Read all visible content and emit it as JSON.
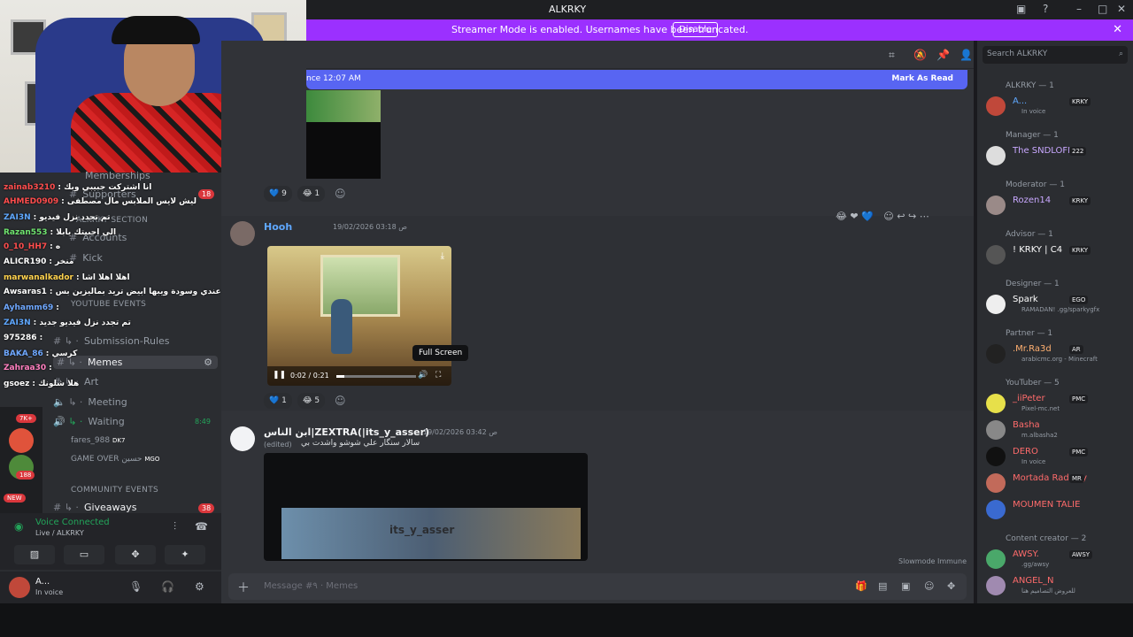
{
  "app": {
    "title": "ALKRKY"
  },
  "banner": {
    "message": "Streamer Mode is enabled. Usernames have been truncated.",
    "disable_label": "Disable"
  },
  "header": {
    "search_placeholder": "Search ALKRKY"
  },
  "newbar": {
    "since": "nce 12:07 AM",
    "mark_read": "Mark As Read"
  },
  "sidebar": {
    "channels": [
      {
        "label": "Memberships"
      },
      {
        "label": "Supporters",
        "badge": "18"
      },
      {
        "label": "Accounts"
      },
      {
        "label": "Kick"
      },
      {
        "label": "Submission-Rules"
      },
      {
        "label": "Memes"
      },
      {
        "label": "Art"
      },
      {
        "label": "Meeting"
      },
      {
        "label": "Waiting",
        "time": "8:49"
      },
      {
        "label": "Giveaways",
        "badge": "38"
      }
    ],
    "categories": [
      "ALKRKY SECTION",
      "YOUTUBE EVENTS",
      "COMMUNITY EVENTS"
    ],
    "voice_users": [
      {
        "name": "fares_988",
        "tag": "DK7"
      },
      {
        "name": "GAME OVER حسين",
        "tag": "MGO"
      }
    ],
    "server_badges": [
      "7K+",
      "188",
      "NEW"
    ]
  },
  "overlay_chat": [
    {
      "user": "zainab3210",
      "text": "انا اشتركت جبيبي وبك",
      "color": "#ff4d4d"
    },
    {
      "user": "AHMED0909",
      "text": "ليش لايس الملابس مال مصطفى",
      "color": "#ff4d4d"
    },
    {
      "user": "ZAI3N",
      "text": "تم تجدد نزل فيديو",
      "color": "#5fa8ff"
    },
    {
      "user": "Razan553",
      "text": "الي احبيتك يابلا",
      "color": "#6fe36f"
    },
    {
      "user": "0_10_HH7",
      "text": "ه",
      "color": "#ff4d4d"
    },
    {
      "user": "ALICR190",
      "text": "منخر",
      "color": "#ffffff"
    },
    {
      "user": "marwanalkador",
      "text": "اهلا اهلا اشا",
      "color": "#ffd24d"
    },
    {
      "user": "Awsaras1",
      "text": "اني عندي وسودة ويبها ابيض تريد بماليزين بس",
      "color": "#ffffff"
    },
    {
      "user": "Ayhamm69",
      "text": "",
      "color": "#6fa8ff"
    },
    {
      "user": "ZAI3N",
      "text": "تم تجدد نزل فيديو جديد",
      "color": "#5fa8ff"
    },
    {
      "user": "975286",
      "text": "",
      "color": "#ffffff"
    },
    {
      "user": "BAKA_86",
      "text": "كرسي",
      "color": "#6fa8ff"
    },
    {
      "user": "Zahraa30",
      "text": "",
      "color": "#ff7fbf"
    },
    {
      "user": "gsoez",
      "text": "هلا شلونك",
      "color": "#ffffff"
    }
  ],
  "voice": {
    "status": "Voice Connected",
    "location": "Live / ALKRKY"
  },
  "user": {
    "name": "A...",
    "status": "In voice"
  },
  "messages": {
    "first_reactions": [
      "9",
      "1"
    ],
    "second": {
      "author": "Hooh",
      "time": "19/02/2026 03:18 ص",
      "video_time": "0:02 / 0:21",
      "progress": 0.1,
      "tooltip": "Full Screen",
      "reactions": [
        "1",
        "5"
      ]
    },
    "third": {
      "author": "ابن الناس|ZEXTRA(|its_y_asser)",
      "time": "19/02/2026 03:42 ص",
      "edited": "(edited)",
      "body": "سالار سنگار علي شوشو واشدت بي",
      "watermark": "its_y_asser"
    }
  },
  "composer": {
    "placeholder": "Message #٩ · Memes",
    "slowmode": "Slowmode Immune"
  },
  "members": [
    {
      "role": "ALKRKY — 1",
      "people": [
        {
          "name": "A...",
          "status": "In voice",
          "tag": "KRKY",
          "color": "#5fa8ff"
        }
      ]
    },
    {
      "role": "Manager — 1",
      "people": [
        {
          "name": "The SNDLOFI",
          "status": "",
          "tag": "222",
          "color": "#c9a8ff"
        }
      ]
    },
    {
      "role": "Moderator — 1",
      "people": [
        {
          "name": "Rozen14",
          "status": "",
          "tag": "KRKY",
          "color": "#c9a8ff"
        }
      ]
    },
    {
      "role": "Advisor — 1",
      "people": [
        {
          "name": "! KRKY | C4",
          "status": "",
          "tag": "KRKY",
          "color": "#ffffff"
        }
      ]
    },
    {
      "role": "Designer — 1",
      "people": [
        {
          "name": "Spark",
          "status": "RAMADAN! .gg/sparkygfx",
          "tag": "EGO",
          "color": "#ffffff"
        }
      ]
    },
    {
      "role": "Partner — 1",
      "people": [
        {
          "name": ".Mr.Ra3d",
          "status": "arabicmc.org - Minecraft",
          "tag": "AR",
          "color": "#ffb070"
        }
      ]
    },
    {
      "role": "YouTuber — 5",
      "people": [
        {
          "name": "_iiPeter",
          "status": "Pixel-mc.net",
          "tag": "PMC",
          "color": "#ff6b6b"
        },
        {
          "name": "Basha",
          "status": "m.albasha2",
          "tag": "",
          "color": "#ff6b6b"
        },
        {
          "name": "DERO",
          "status": "In voice",
          "tag": "PMC",
          "color": "#ff6b6b"
        },
        {
          "name": "Mortada Radawy",
          "status": "",
          "tag": "MR",
          "color": "#ff6b6b"
        },
        {
          "name": "MOUMEN TALIE",
          "status": "",
          "tag": "",
          "color": "#ff6b6b"
        }
      ]
    },
    {
      "role": "Content creator — 2",
      "people": [
        {
          "name": "AWSY.",
          "status": ".gg/awsy",
          "tag": "AWSY",
          "color": "#ff6b6b"
        },
        {
          "name": "ANGEL_N",
          "status": "للعروض التصاميم هنا",
          "tag": "",
          "color": "#ff6b6b"
        }
      ]
    }
  ]
}
